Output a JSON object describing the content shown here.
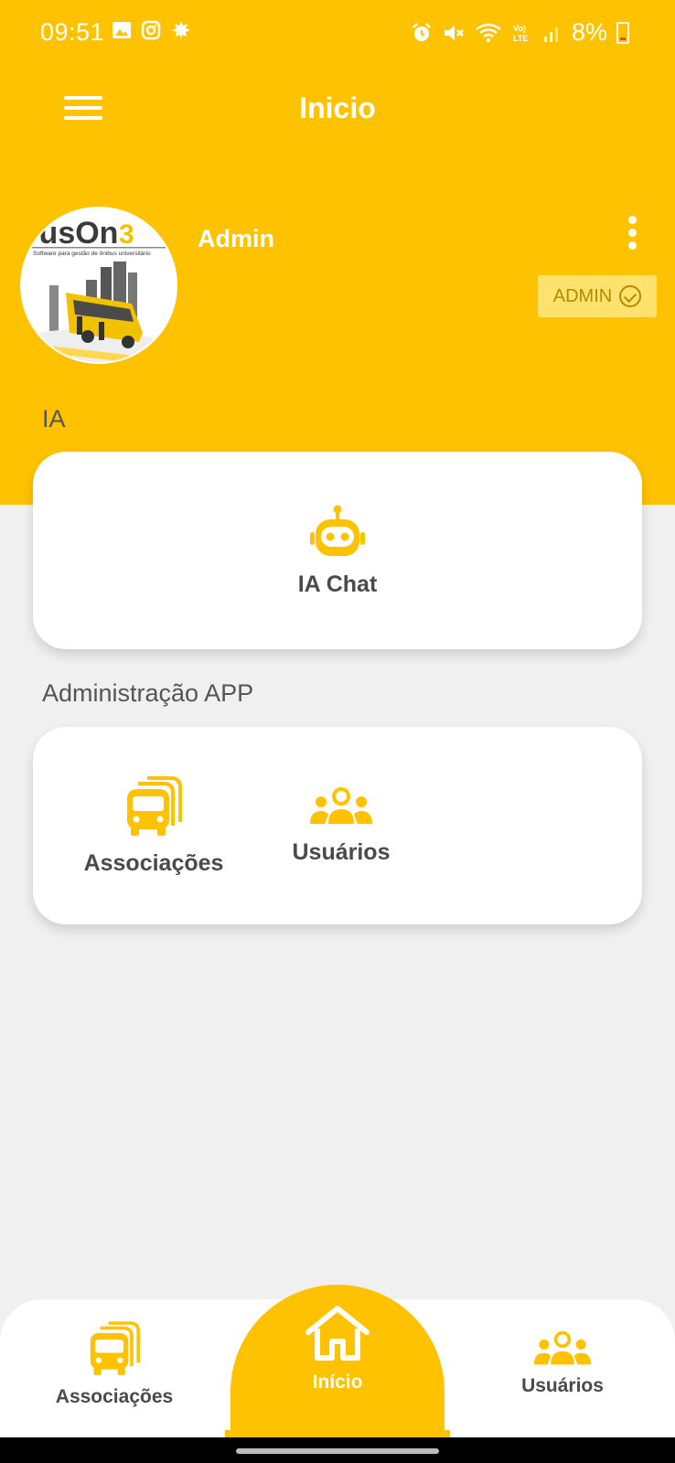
{
  "status_bar": {
    "time": "09:51",
    "battery": "8%",
    "icons": [
      "gallery-icon",
      "instagram-icon",
      "leaf-icon",
      "alarm-icon",
      "mute-icon",
      "wifi-icon",
      "volte-icon",
      "signal-icon",
      "battery-icon"
    ]
  },
  "app_bar": {
    "title": "Inicio"
  },
  "profile": {
    "name": "Admin",
    "role": "ADMIN",
    "logo_text": "BusOn",
    "logo_tagline": "Software para gestão de ônibus universitário"
  },
  "sections": {
    "ia": {
      "title": "IA",
      "items": [
        {
          "label": "IA Chat",
          "icon": "robot-icon"
        }
      ]
    },
    "admin": {
      "title": "Administração APP",
      "items": [
        {
          "label": "Associações",
          "icon": "bus-icon"
        },
        {
          "label": "Usuários",
          "icon": "users-icon"
        }
      ]
    }
  },
  "bottom_nav": {
    "items": [
      {
        "label": "Associações",
        "icon": "bus-icon"
      },
      {
        "label": "Início",
        "icon": "home-icon",
        "active": true
      },
      {
        "label": "Usuários",
        "icon": "users-icon"
      }
    ]
  },
  "colors": {
    "primary": "#FFC200",
    "badge": "#FFE26E",
    "text": "#4a4a4a",
    "background": "#f0f0f0"
  }
}
